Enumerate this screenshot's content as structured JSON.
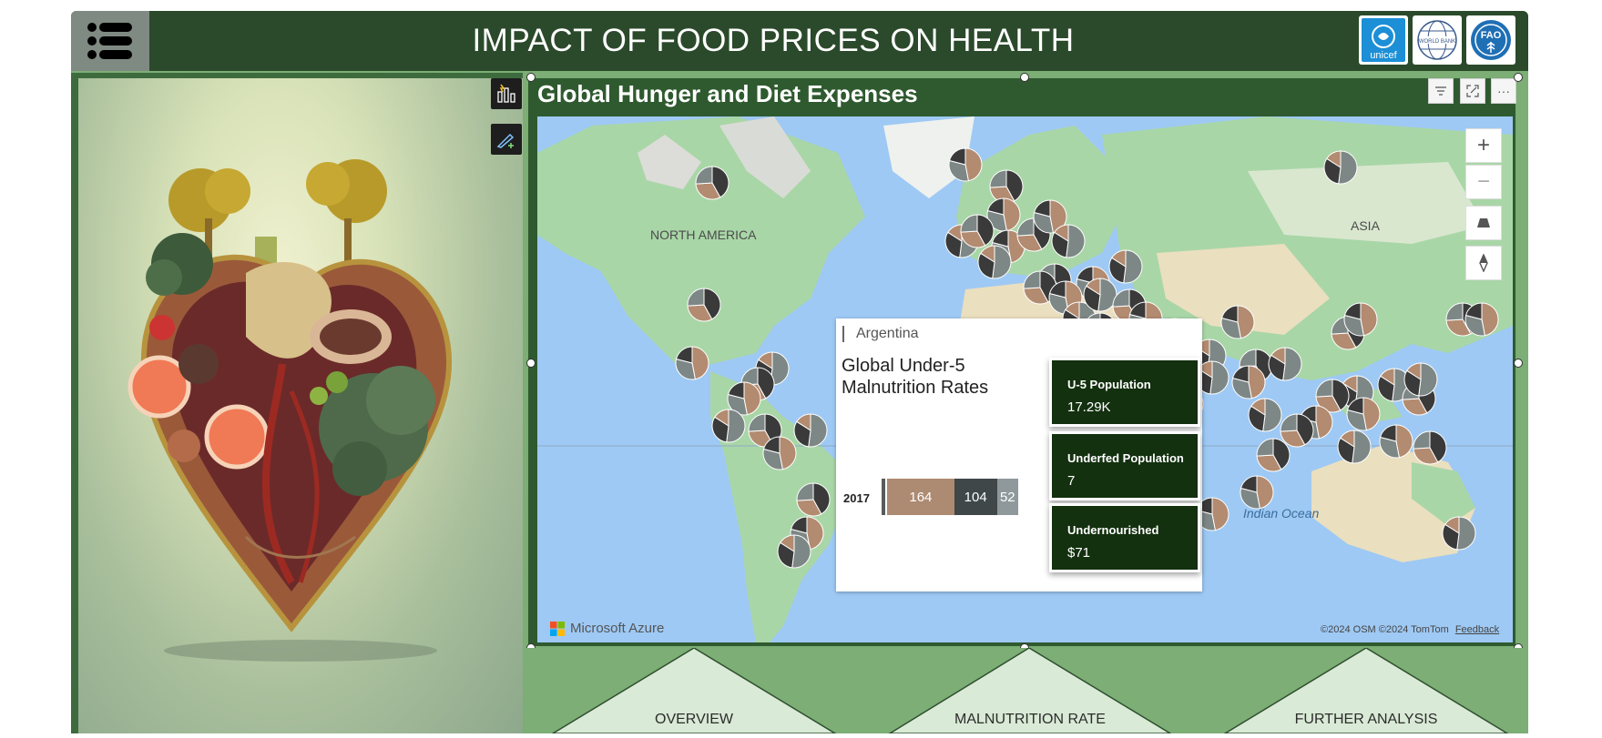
{
  "header": {
    "title": "IMPACT OF FOOD PRICES ON HEALTH",
    "menu_icon": "hamburger-icon",
    "logos": [
      {
        "name": "unicef-logo",
        "text": "unicef"
      },
      {
        "name": "world-bank-logo",
        "text": "WORLD BANK"
      },
      {
        "name": "fao-logo",
        "text": "FAO"
      }
    ]
  },
  "left_panel": {
    "image": "heart-of-food-illustration",
    "tools": [
      "visual-edit-icon",
      "format-brush-icon"
    ]
  },
  "map_visual": {
    "title": "Global Hunger and Diet Expenses",
    "header_buttons": [
      "filter-icon",
      "focus-mode-icon",
      "more-options-icon"
    ],
    "labels": {
      "north_america": "NORTH AMERICA",
      "asia": "ASIA",
      "indian_ocean": "Indian Ocean"
    },
    "controls": {
      "zoom_in": "+",
      "zoom_out": "−"
    },
    "attribution": "Microsoft Azure",
    "copyright": "©2024 OSM  ©2024 TomTom",
    "feedback": "Feedback"
  },
  "tooltip": {
    "country": "Argentina",
    "heading": "Global Under-5 Malnutrition Rates",
    "chart_data": {
      "type": "bar",
      "categories": [
        "2017"
      ],
      "series": [
        {
          "values": [
            164
          ]
        },
        {
          "values": [
            104
          ]
        },
        {
          "values": [
            52
          ]
        }
      ]
    },
    "kpis": [
      {
        "label": "U-5 Population",
        "value": "17.29K"
      },
      {
        "label": "Underfed Population",
        "value": "7"
      },
      {
        "label": "Undernourished",
        "value": "$71"
      }
    ]
  },
  "nav": {
    "buttons": [
      "OVERVIEW",
      "MALNUTRITION RATE",
      "FURTHER ANALYSIS"
    ]
  },
  "colors": {
    "header": "#2b4a2b",
    "accent_green": "#7cae76",
    "kpi_bg": "#13300f",
    "pie_dark": "#3a3a3a",
    "pie_tan": "#b38b70",
    "pie_grey": "#7d8786"
  }
}
